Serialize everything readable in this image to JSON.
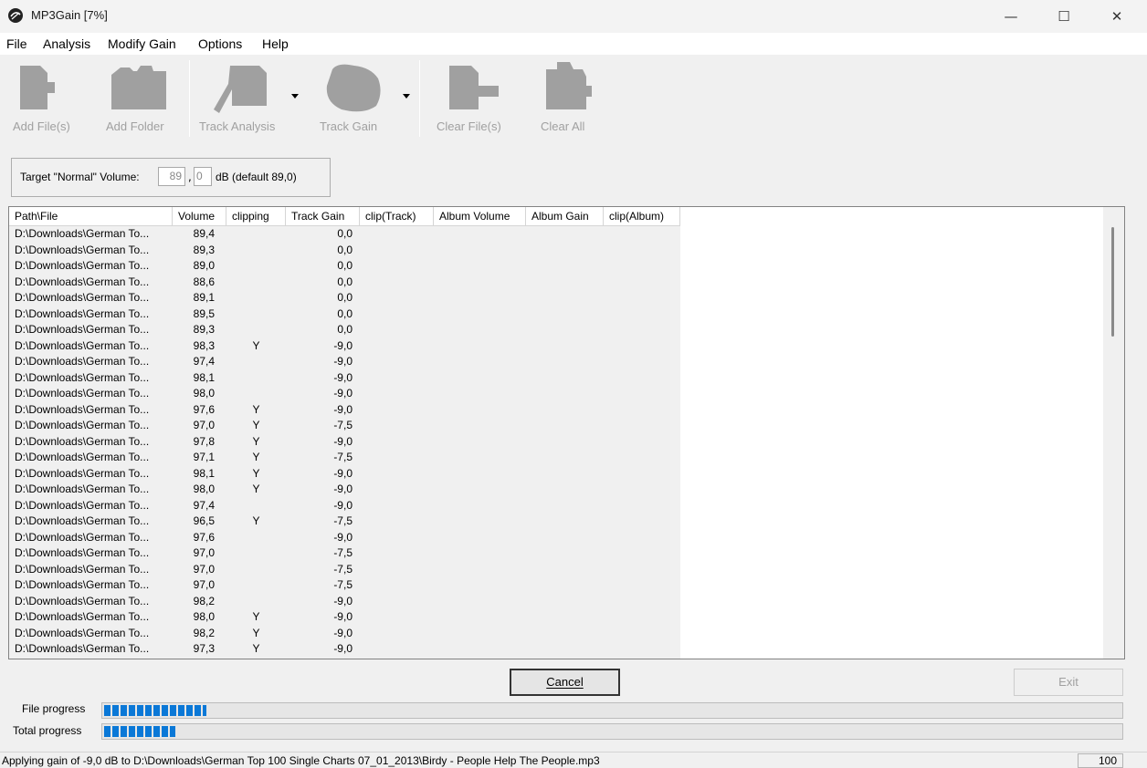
{
  "window": {
    "title": "MP3Gain [7%]",
    "minimize_glyph": "—",
    "maximize_glyph": "☐",
    "close_glyph": "✕"
  },
  "menu": {
    "items": [
      "File",
      "Analysis",
      "Modify Gain",
      "Options",
      "Help"
    ]
  },
  "toolbar": {
    "add_files": "Add File(s)",
    "add_folder": "Add Folder",
    "track_analysis": "Track Analysis",
    "track_gain": "Track Gain",
    "clear_files": "Clear File(s)",
    "clear_all": "Clear All",
    "icon_color": "#a0a0a0"
  },
  "target": {
    "label": "Target \"Normal\" Volume:",
    "int_value": "89",
    "dec_value": "0",
    "separator": ",",
    "unit_default": "dB  (default 89,0)"
  },
  "table": {
    "columns": [
      "Path\\File",
      "Volume",
      "clipping",
      "Track Gain",
      "clip(Track)",
      "Album Volume",
      "Album Gain",
      "clip(Album)"
    ],
    "rows": [
      [
        "D:\\Downloads\\German To...",
        "89,4",
        "",
        "0,0"
      ],
      [
        "D:\\Downloads\\German To...",
        "89,3",
        "",
        "0,0"
      ],
      [
        "D:\\Downloads\\German To...",
        "89,0",
        "",
        "0,0"
      ],
      [
        "D:\\Downloads\\German To...",
        "88,6",
        "",
        "0,0"
      ],
      [
        "D:\\Downloads\\German To...",
        "89,1",
        "",
        "0,0"
      ],
      [
        "D:\\Downloads\\German To...",
        "89,5",
        "",
        "0,0"
      ],
      [
        "D:\\Downloads\\German To...",
        "89,3",
        "",
        "0,0"
      ],
      [
        "D:\\Downloads\\German To...",
        "98,3",
        "Y",
        "-9,0"
      ],
      [
        "D:\\Downloads\\German To...",
        "97,4",
        "",
        "-9,0"
      ],
      [
        "D:\\Downloads\\German To...",
        "98,1",
        "",
        "-9,0"
      ],
      [
        "D:\\Downloads\\German To...",
        "98,0",
        "",
        "-9,0"
      ],
      [
        "D:\\Downloads\\German To...",
        "97,6",
        "Y",
        "-9,0"
      ],
      [
        "D:\\Downloads\\German To...",
        "97,0",
        "Y",
        "-7,5"
      ],
      [
        "D:\\Downloads\\German To...",
        "97,8",
        "Y",
        "-9,0"
      ],
      [
        "D:\\Downloads\\German To...",
        "97,1",
        "Y",
        "-7,5"
      ],
      [
        "D:\\Downloads\\German To...",
        "98,1",
        "Y",
        "-9,0"
      ],
      [
        "D:\\Downloads\\German To...",
        "98,0",
        "Y",
        "-9,0"
      ],
      [
        "D:\\Downloads\\German To...",
        "97,4",
        "",
        "-9,0"
      ],
      [
        "D:\\Downloads\\German To...",
        "96,5",
        "Y",
        "-7,5"
      ],
      [
        "D:\\Downloads\\German To...",
        "97,6",
        "",
        "-9,0"
      ],
      [
        "D:\\Downloads\\German To...",
        "97,0",
        "",
        "-7,5"
      ],
      [
        "D:\\Downloads\\German To...",
        "97,0",
        "",
        "-7,5"
      ],
      [
        "D:\\Downloads\\German To...",
        "97,0",
        "",
        "-7,5"
      ],
      [
        "D:\\Downloads\\German To...",
        "98,2",
        "",
        "-9,0"
      ],
      [
        "D:\\Downloads\\German To...",
        "98,0",
        "Y",
        "-9,0"
      ],
      [
        "D:\\Downloads\\German To...",
        "98,2",
        "Y",
        "-9,0"
      ],
      [
        "D:\\Downloads\\German To...",
        "97,3",
        "Y",
        "-9,0"
      ]
    ]
  },
  "buttons": {
    "cancel": "Cancel",
    "exit": "Exit"
  },
  "progress": {
    "file_label": "File progress",
    "total_label": "Total progress",
    "file_fraction": 0.1,
    "total_fraction": 0.07,
    "bar_color": "#0a78d7"
  },
  "status": {
    "text": "Applying gain of -9,0 dB to D:\\Downloads\\German Top 100 Single Charts 07_01_2013\\Birdy - People Help The People.mp3",
    "value": "100"
  }
}
